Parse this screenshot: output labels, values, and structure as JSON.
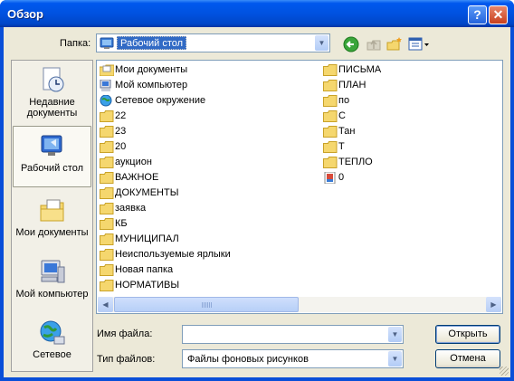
{
  "window": {
    "title": "Обзор",
    "help_glyph": "?",
    "close_glyph": "✕"
  },
  "toolbar": {
    "lookin_label": "Папка:",
    "lookin_value": "Рабочий стол",
    "icons": [
      "back-icon",
      "up-folder-icon",
      "new-folder-icon",
      "view-menu-icon"
    ]
  },
  "places": [
    {
      "label": "Недавние документы",
      "icon": "recent-documents-icon"
    },
    {
      "label": "Рабочий стол",
      "icon": "desktop-icon",
      "selected": true
    },
    {
      "label": "Мои документы",
      "icon": "my-documents-icon"
    },
    {
      "label": "Мой компьютер",
      "icon": "my-computer-icon"
    },
    {
      "label": "Сетевое",
      "icon": "network-icon"
    }
  ],
  "files": {
    "col1": [
      {
        "name": "Мои документы",
        "icon": "my-documents-icon"
      },
      {
        "name": "Мой компьютер",
        "icon": "my-computer-icon"
      },
      {
        "name": "Сетевое окружение",
        "icon": "network-icon"
      },
      {
        "name": "22",
        "icon": "folder-icon"
      },
      {
        "name": "23",
        "icon": "folder-icon"
      },
      {
        "name": "20",
        "icon": "folder-icon"
      },
      {
        "name": "аукцион",
        "icon": "folder-icon"
      },
      {
        "name": "ВАЖНОЕ",
        "icon": "folder-icon"
      },
      {
        "name": "ДОКУМЕНТЫ",
        "icon": "folder-icon"
      },
      {
        "name": "заявка",
        "icon": "folder-icon"
      },
      {
        "name": "КБ",
        "icon": "folder-icon"
      },
      {
        "name": "МУНИЦИПАЛ",
        "icon": "folder-icon"
      },
      {
        "name": "Неиспользуемые ярлыки",
        "icon": "folder-icon"
      },
      {
        "name": "Новая папка",
        "icon": "folder-icon"
      },
      {
        "name": "НОРМАТИВЫ",
        "icon": "folder-icon"
      }
    ],
    "col2": [
      {
        "name": "ПИСЬМА",
        "icon": "folder-icon"
      },
      {
        "name": "ПЛАН",
        "icon": "folder-icon"
      },
      {
        "name": "по",
        "icon": "folder-icon"
      },
      {
        "name": "С",
        "icon": "folder-icon"
      },
      {
        "name": "Тан",
        "icon": "folder-icon"
      },
      {
        "name": "Т",
        "icon": "folder-icon"
      },
      {
        "name": "ТЕПЛО",
        "icon": "folder-icon"
      },
      {
        "name": "0",
        "icon": "image-file-icon"
      }
    ]
  },
  "filename": {
    "label": "Имя файла:",
    "value": ""
  },
  "filetype": {
    "label": "Тип файлов:",
    "value": "Файлы фоновых рисунков"
  },
  "buttons": {
    "open": "Открыть",
    "cancel": "Отмена"
  },
  "colors": {
    "titlebar": "#0054e3",
    "selection": "#316ac5",
    "dialog_bg": "#ece9d8"
  }
}
